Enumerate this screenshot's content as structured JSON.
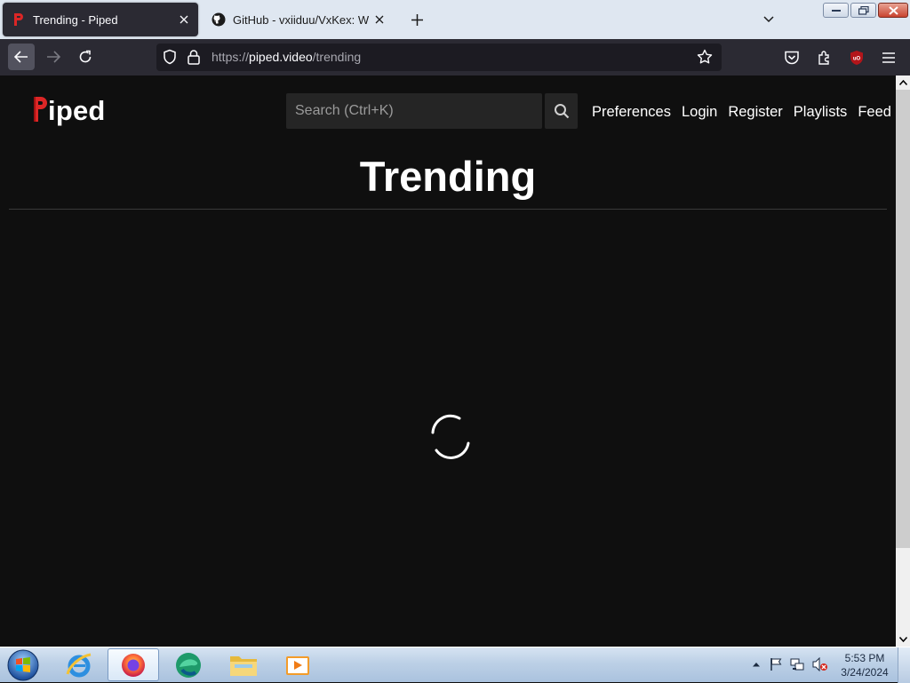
{
  "browser": {
    "tabs": [
      {
        "title": "Trending - Piped",
        "active": true
      },
      {
        "title": "GitHub - vxiiduu/VxKex: Windo",
        "active": false
      }
    ],
    "url": {
      "prefix": "https://",
      "domain": "piped.video",
      "path": "/trending"
    }
  },
  "page": {
    "logo": {
      "letter": "P",
      "rest": "iped"
    },
    "search_placeholder": "Search (Ctrl+K)",
    "nav_links": [
      "Preferences",
      "Login",
      "Register",
      "Playlists",
      "Feed"
    ],
    "title": "Trending",
    "loading": true
  },
  "taskbar": {
    "apps": [
      "internet-explorer",
      "firefox",
      "edge",
      "file-explorer",
      "media-player"
    ],
    "active_app": "firefox",
    "clock": {
      "time": "5:53 PM",
      "date": "3/24/2024"
    }
  },
  "colors": {
    "page_bg": "#0f0f0f",
    "piped_red": "#dc2626",
    "browser_chrome": "#2b2a33",
    "tabstrip": "#dfe7f1"
  }
}
